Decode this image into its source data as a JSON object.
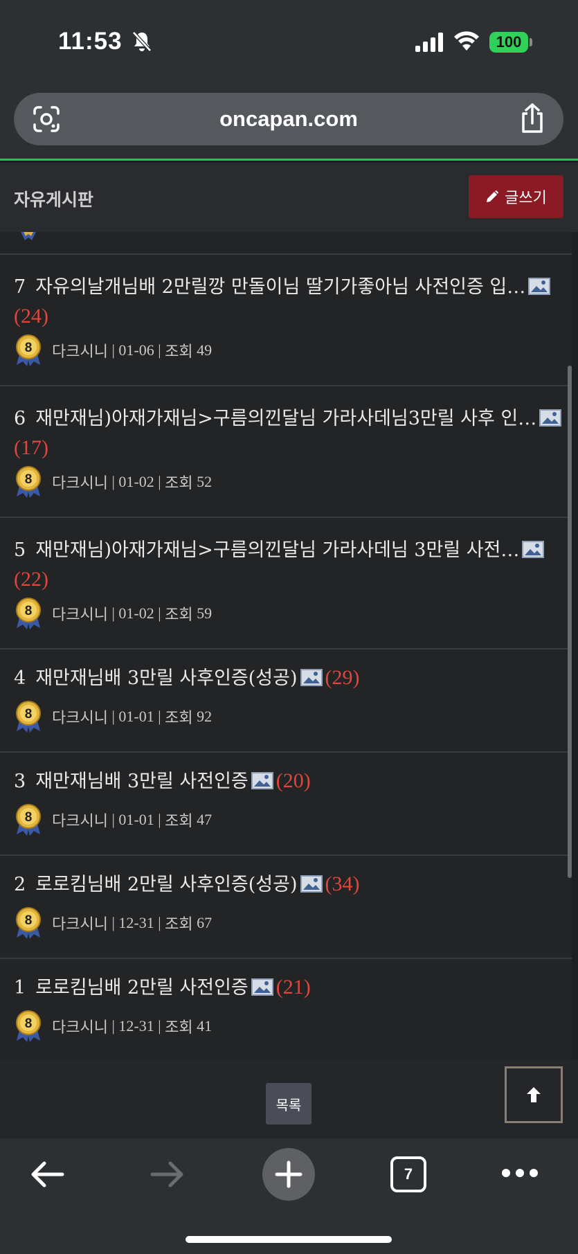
{
  "status": {
    "time": "11:53",
    "battery": "100"
  },
  "browser": {
    "url": "oncapan.com",
    "tab_count": "7"
  },
  "board": {
    "title": "자유게시판",
    "write_label": "글쓰기"
  },
  "posts": [
    {
      "num": "7",
      "title": "자유의날개님배 2만릴깡 만돌이님 딸기가좋아님 사전인증 입…",
      "comments": "(24)",
      "author": "다크시니",
      "date": "01-06",
      "views_label": "조회",
      "views": "49"
    },
    {
      "num": "6",
      "title": "재만재님)아재가재님>구름의낀달님 가라사데님3만릴 사후 인…",
      "comments": "(17)",
      "author": "다크시니",
      "date": "01-02",
      "views_label": "조회",
      "views": "52"
    },
    {
      "num": "5",
      "title": "재만재님)아재가재님>구름의낀달님 가라사데님 3만릴 사전…",
      "comments": "(22)",
      "author": "다크시니",
      "date": "01-02",
      "views_label": "조회",
      "views": "59"
    },
    {
      "num": "4",
      "title": "재만재님배 3만릴 사후인증(성공)",
      "comments": "(29)",
      "author": "다크시니",
      "date": "01-01",
      "views_label": "조회",
      "views": "92"
    },
    {
      "num": "3",
      "title": "재만재님배 3만릴 사전인증",
      "comments": "(20)",
      "author": "다크시니",
      "date": "01-01",
      "views_label": "조회",
      "views": "47"
    },
    {
      "num": "2",
      "title": "로로킴님배 2만릴 사후인증(성공)",
      "comments": "(34)",
      "author": "다크시니",
      "date": "12-31",
      "views_label": "조회",
      "views": "67"
    },
    {
      "num": "1",
      "title": "로로킴님배 2만릴 사전인증",
      "comments": "(21)",
      "author": "다크시니",
      "date": "12-31",
      "views_label": "조회",
      "views": "41"
    }
  ],
  "medal_level": "8",
  "footer": {
    "list_label": "목록"
  },
  "icons": [
    "bell-slash-icon",
    "signal-icon",
    "wifi-icon",
    "scan-icon",
    "share-icon",
    "pencil-icon",
    "image-icon",
    "medal-icon",
    "arrow-up-icon",
    "back-arrow-icon",
    "forward-arrow-icon",
    "new-tab-icon",
    "tabs-icon",
    "more-icon"
  ],
  "colors": {
    "accent_green": "#2fbf4f",
    "write_button": "#8b1a25",
    "comment_count": "#e0463d",
    "battery": "#30d158"
  }
}
